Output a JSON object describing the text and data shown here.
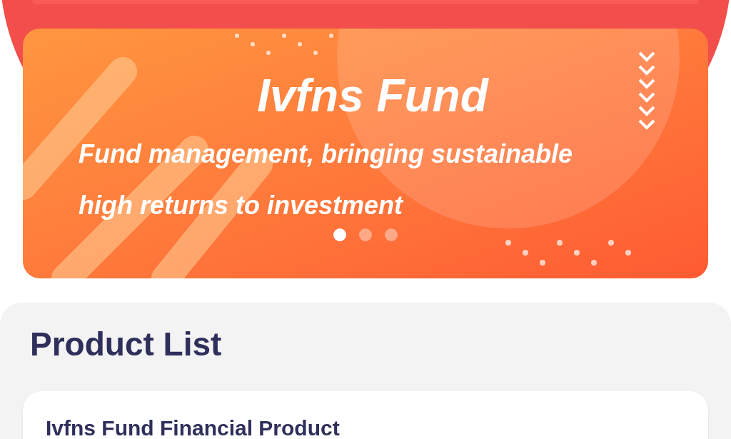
{
  "banner": {
    "title": "Ivfns Fund",
    "subtitle_lines": [
      "Fund management, bringing sustainable",
      "high returns to investment"
    ],
    "dots": [
      {
        "selected": true
      },
      {
        "selected": false
      },
      {
        "selected": false
      }
    ]
  },
  "product_list": {
    "title": "Product List",
    "products": [
      {
        "name": "Ivfns Fund Financial Product"
      }
    ]
  }
}
